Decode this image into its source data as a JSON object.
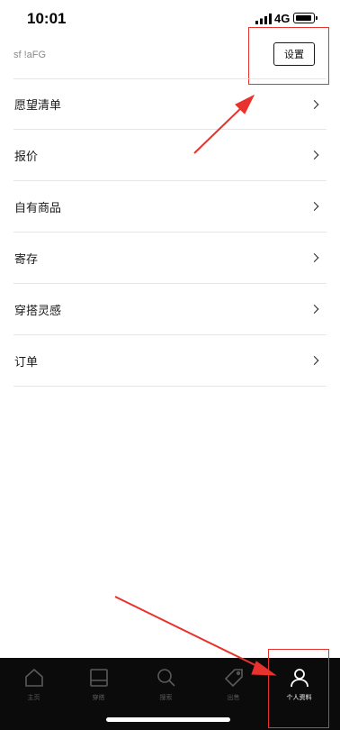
{
  "status_bar": {
    "time": "10:01",
    "network": "4G"
  },
  "header": {
    "username": "sf !aFG",
    "settings_label": "设置"
  },
  "menu": {
    "items": [
      {
        "label": "愿望清单"
      },
      {
        "label": "报价"
      },
      {
        "label": "自有商品"
      },
      {
        "label": "寄存"
      },
      {
        "label": "穿搭灵感"
      },
      {
        "label": "订单"
      }
    ]
  },
  "tabbar": {
    "items": [
      {
        "label": "主页",
        "icon": "home-icon"
      },
      {
        "label": "穿搭",
        "icon": "wardrobe-icon"
      },
      {
        "label": "搜索",
        "icon": "search-icon"
      },
      {
        "label": "出售",
        "icon": "tag-icon"
      },
      {
        "label": "个人资料",
        "icon": "profile-icon",
        "active": true
      }
    ]
  },
  "colors": {
    "annotation": "#e8322e",
    "tabbar_bg": "#0b0b0b",
    "divider": "#e6e6e6"
  }
}
